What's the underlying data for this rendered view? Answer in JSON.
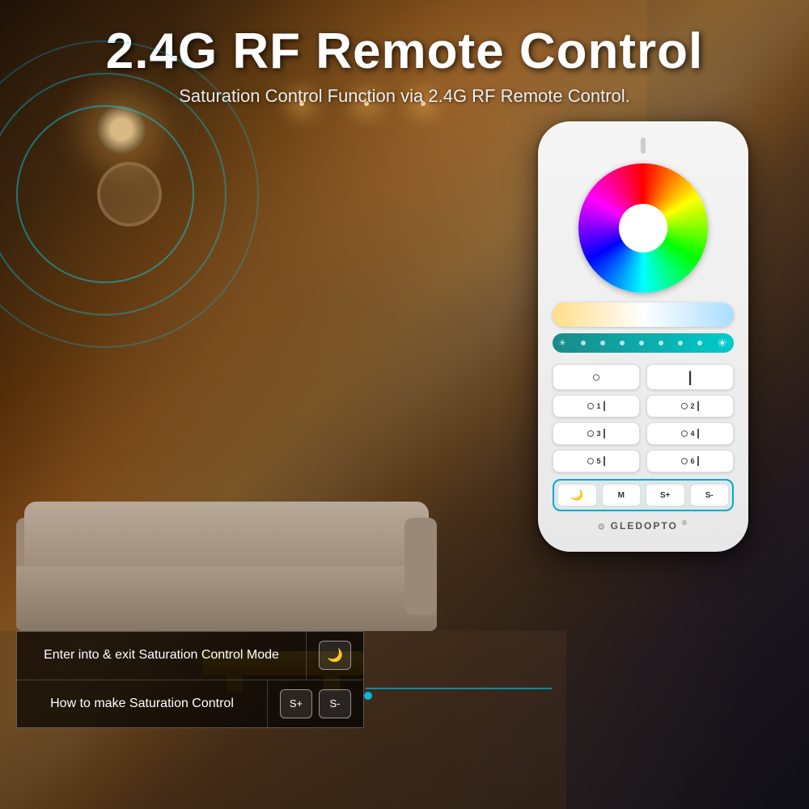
{
  "page": {
    "background_color": "#1a0a00"
  },
  "header": {
    "title": "2.4G RF Remote Control",
    "subtitle": "Saturation Control Function via 2.4G RF Remote Control."
  },
  "remote": {
    "color_wheel_label": "color wheel",
    "bottom_buttons": {
      "moon": "🌙",
      "m": "M",
      "s_plus": "S+",
      "s_minus": "S-"
    },
    "numbered_rows": [
      {
        "left_circle": "o",
        "left_num": "1",
        "left_line": "|",
        "right_circle": "o",
        "right_num": "2",
        "right_line": "|"
      },
      {
        "left_circle": "o",
        "left_num": "3",
        "left_line": "|",
        "right_circle": "o",
        "right_num": "4",
        "right_line": "|"
      },
      {
        "left_circle": "o",
        "left_num": "5",
        "left_line": "|",
        "right_circle": "o",
        "right_num": "6",
        "right_line": "|"
      }
    ],
    "logo": "GLEDOPTO"
  },
  "info_box": {
    "row1": {
      "text": "Enter into & exit Saturation Control Mode",
      "icon": "🌙"
    },
    "row2": {
      "text": "How to make Saturation Control",
      "btn1": "S+",
      "btn2": "S-"
    }
  }
}
